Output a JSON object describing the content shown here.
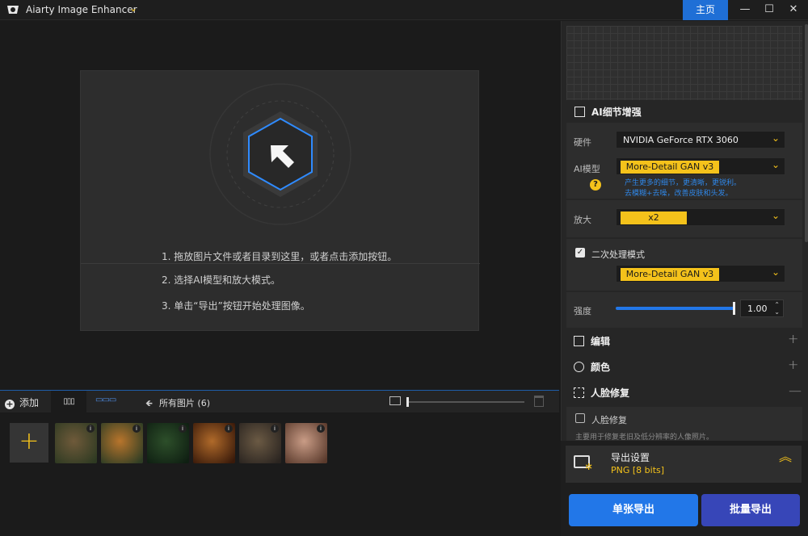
{
  "titlebar": {
    "app_title": "Aiarty Image Enhancer",
    "home_label": "主页",
    "minimize": "—",
    "maximize": "☐",
    "close": "✕",
    "accent": "#1f6fd6"
  },
  "dropzone": {
    "step1": "1. 拖放图片文件或者目录到这里，或者点击添加按钮。",
    "step2": "2. 选择AI模型和放大模式。",
    "step3": "3. 单击“导出”按钮开始处理图像。"
  },
  "toolbar": {
    "add_label": "添加",
    "grid_view": "▯▯▯",
    "strip_view": "▭▭▭",
    "all_pictures_label": "所有图片 (6)",
    "zoom_level": 0
  },
  "thumbnails": [
    {
      "name": "butterfly",
      "c1": "#6f5a3a",
      "c2": "#2e3a22"
    },
    {
      "name": "tiger",
      "c1": "#b8752c",
      "c2": "#2f3d24"
    },
    {
      "name": "forest-cup",
      "c1": "#2d4f2a",
      "c2": "#0f1f12"
    },
    {
      "name": "burger",
      "c1": "#b06a2a",
      "c2": "#3a1a0a"
    },
    {
      "name": "armored-animal",
      "c1": "#6b5a44",
      "c2": "#2a2420"
    },
    {
      "name": "portrait",
      "c1": "#c99c86",
      "c2": "#5a3a2c"
    }
  ],
  "panel": {
    "ai_detail_title": "AI细节增强",
    "hardware_label": "硬件",
    "hardware_value": "NVIDIA GeForce RTX 3060",
    "model_label": "AI模型",
    "model_value": "More-Detail GAN  v3",
    "model_hint_line1": "产生更多的细节，更清晰，更锐利。",
    "model_hint_line2": "去模糊+去噪，改善皮肤和头发。",
    "scale_label": "放大",
    "scale_value": "x2",
    "second_pass_label": "二次处理模式",
    "second_pass_checked": true,
    "second_pass_model": "More-Detail GAN  v3",
    "strength_label": "强度",
    "strength_value": "1.00",
    "edit_title": "编辑",
    "color_title": "颜色",
    "face_title": "人脸修复",
    "face_checkbox_label": "人脸修复",
    "face_hint": "主要用于修复老旧及低分辨率的人像照片。",
    "export_title": "导出设置",
    "export_format": "PNG   [8 bits]",
    "single_export": "单张导出",
    "batch_export": "批量导出"
  }
}
